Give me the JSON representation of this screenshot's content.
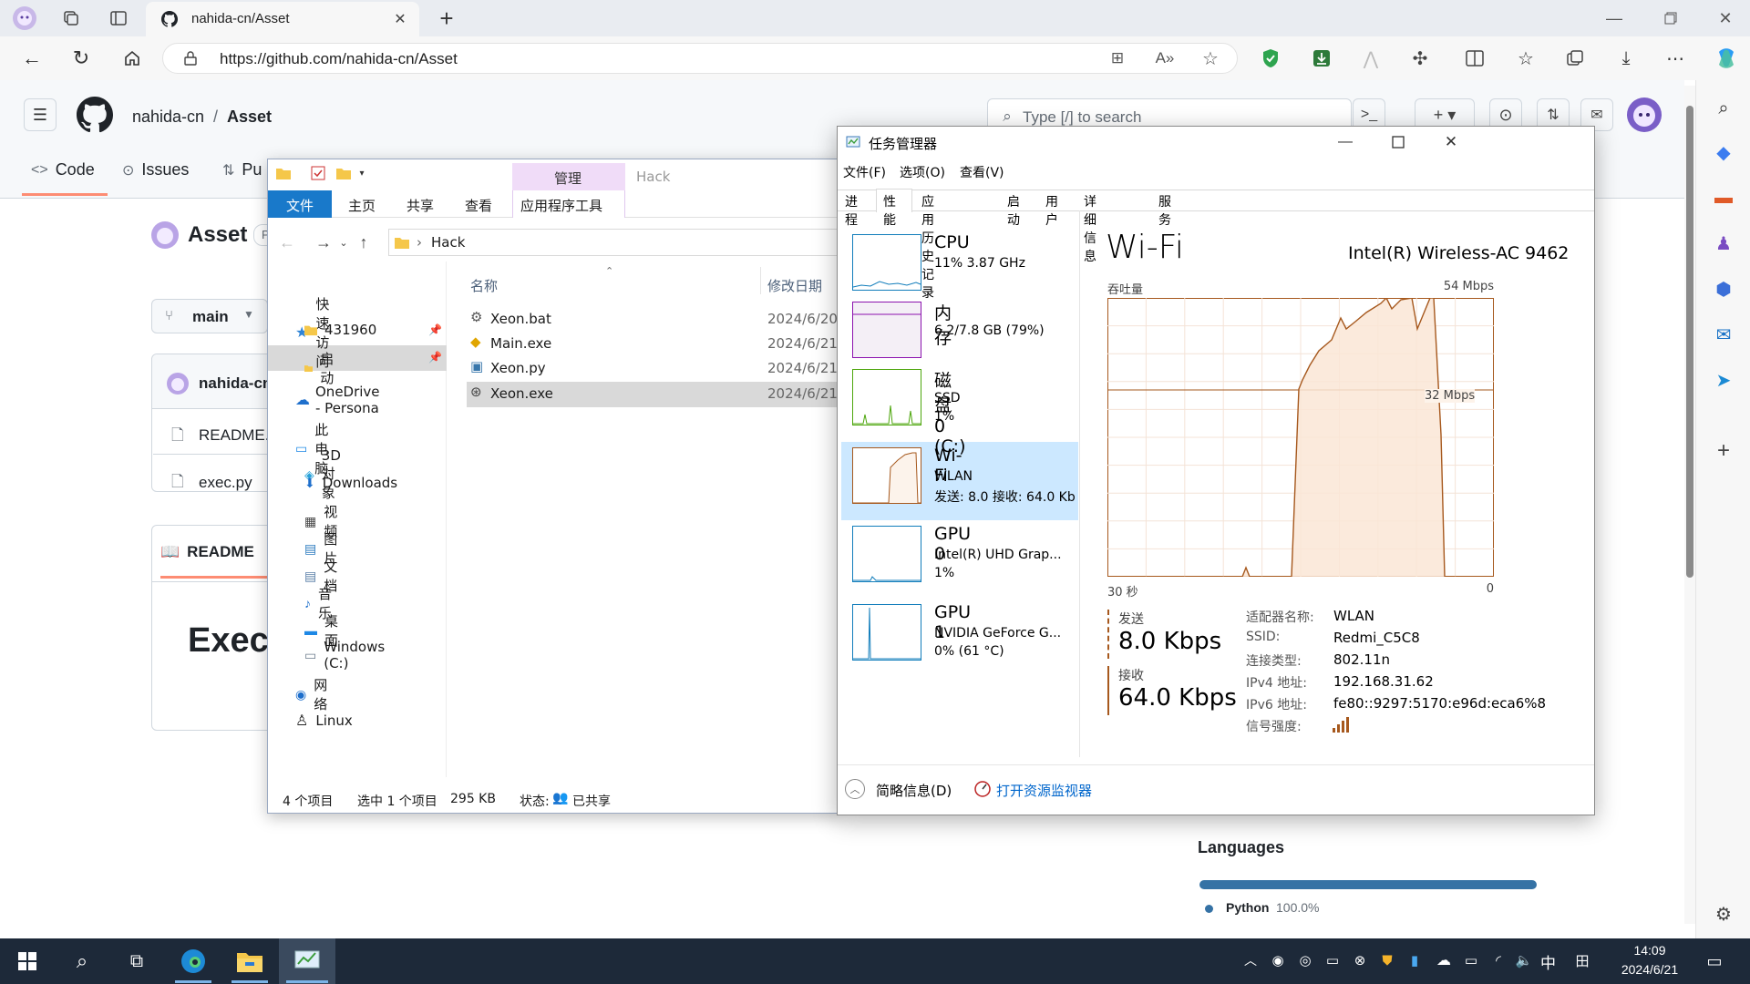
{
  "browser": {
    "tab_title": "nahida-cn/Asset",
    "url": "https://github.com/nahida-cn/Asset"
  },
  "github": {
    "owner": "nahida-cn",
    "separator": "/",
    "repo": "Asset",
    "search_placeholder": "Type [/] to search",
    "tabs": {
      "code": "Code",
      "issues": "Issues",
      "pulls": "Pu"
    },
    "repo_title": "Asset",
    "repo_badge": "P",
    "branch": "main",
    "commit_owner": "nahida-cn",
    "files": [
      {
        "name": "README.md"
      },
      {
        "name": "exec.py"
      }
    ],
    "readme_tab": "README",
    "readme_heading": "Execu",
    "languages_title": "Languages",
    "language": "Python",
    "language_pct": "100.0%",
    "language_share": 1.0,
    "language_color": "#3572A5"
  },
  "explorer": {
    "ribbon_manage": "管理",
    "ribbon_folder": "Hack",
    "menu_file": "文件",
    "menu_home": "主页",
    "menu_share": "共享",
    "menu_view": "查看",
    "menu_apptools": "应用程序工具",
    "path": "Hack",
    "nav": {
      "quick_access": "快速访问",
      "folder1": "431960",
      "folder2": "启动",
      "onedrive": "OneDrive - Persona",
      "this_pc": "此电脑",
      "obj3d": "3D 对象",
      "downloads": "Downloads",
      "videos": "视频",
      "pictures": "图片",
      "documents": "文档",
      "music": "音乐",
      "desktop": "桌面",
      "windows_c": "Windows (C:)",
      "network": "网络",
      "linux": "Linux"
    },
    "col_name": "名称",
    "col_modified": "修改日期",
    "files": [
      {
        "name": "Xeon.bat",
        "date": "2024/6/20"
      },
      {
        "name": "Main.exe",
        "date": "2024/6/21"
      },
      {
        "name": "Xeon.py",
        "date": "2024/6/21"
      },
      {
        "name": "Xeon.exe",
        "date": "2024/6/21"
      }
    ],
    "status_items": "4 个项目",
    "status_selected": "选中 1 个项目",
    "status_size": "295 KB",
    "status_state_label": "状态:",
    "status_state_value": "已共享"
  },
  "taskmgr": {
    "title": "任务管理器",
    "menu": {
      "file": "文件(F)",
      "options": "选项(O)",
      "view": "查看(V)"
    },
    "tabs": [
      "进程",
      "性能",
      "应用历史记录",
      "启动",
      "用户",
      "详细信息",
      "服务"
    ],
    "side": [
      {
        "name": "CPU",
        "l1": "11% 3.87 GHz",
        "l2": ""
      },
      {
        "name": "内存",
        "l1": "6.2/7.8 GB (79%)",
        "l2": ""
      },
      {
        "name": "磁盘 0 (C:)",
        "l1": "SSD",
        "l2": "1%"
      },
      {
        "name": "Wi-Fi",
        "l1": "WLAN",
        "l2": "发送: 8.0 接收: 64.0 Kb"
      },
      {
        "name": "GPU 0",
        "l1": "Intel(R) UHD Grap...",
        "l2": "1%"
      },
      {
        "name": "GPU 1",
        "l1": "NVIDIA GeForce G...",
        "l2": "0% (61 °C)"
      }
    ],
    "main_title": "Wi-Fi",
    "adapter": "Intel(R) Wireless-AC 9462",
    "throughput_label": "吞吐量",
    "max_label": "54 Mbps",
    "mid_label": "32 Mbps",
    "x_left": "30 秒",
    "x_right": "0",
    "send_label": "发送",
    "send_value": "8.0 Kbps",
    "recv_label": "接收",
    "recv_value": "64.0 Kbps",
    "details": [
      {
        "k": "适配器名称:",
        "v": "WLAN"
      },
      {
        "k": "SSID:",
        "v": "Redmi_C5C8"
      },
      {
        "k": "连接类型:",
        "v": "802.11n"
      },
      {
        "k": "IPv4 地址:",
        "v": "192.168.31.62"
      },
      {
        "k": "IPv6 地址:",
        "v": "fe80::9297:5170:e96d:eca6%8"
      },
      {
        "k": "信号强度:",
        "v": ""
      }
    ],
    "brief": "简略信息(D)",
    "resmon": "打开资源监视器",
    "accent": "#a6581d"
  },
  "taskbar": {
    "time": "14:09",
    "date": "2024/6/21",
    "ime": "中"
  }
}
